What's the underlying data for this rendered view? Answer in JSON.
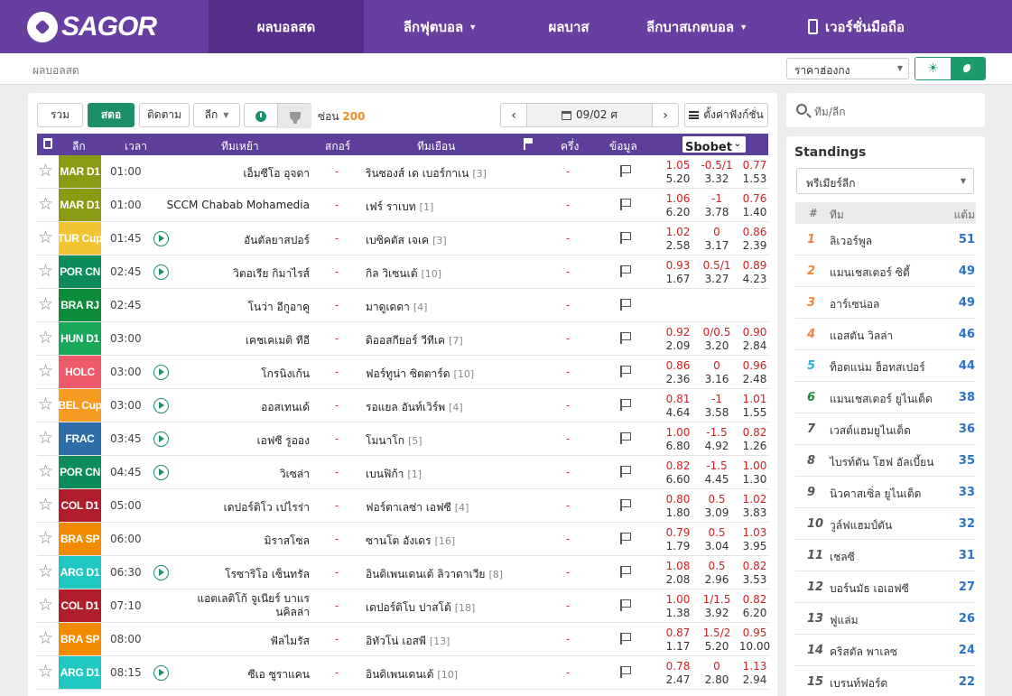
{
  "header": {
    "logo_text": "SAGOR",
    "nav": [
      {
        "label": "ผลบอลสด",
        "active": true,
        "caret": false
      },
      {
        "label": "ลีกฟุตบอล",
        "active": false,
        "caret": true
      },
      {
        "label": "ผลบาส",
        "active": false,
        "caret": false
      },
      {
        "label": "ลีกบาสเกตบอล",
        "active": false,
        "caret": true
      },
      {
        "label": "เวอร์ชั่นมือถือ",
        "active": false,
        "caret": false,
        "phone_icon": true
      }
    ],
    "caret_glyph": "▼"
  },
  "subbar": {
    "breadcrumb": "ผลบอลสด",
    "price_select": "ราคาฮ่องกง",
    "theme_light_icon": "sun-icon",
    "theme_dark_icon": "moon-icon"
  },
  "toolbar": {
    "all_label": "รวม",
    "live_label": "สดอ",
    "follow_label": "ติดตาม",
    "league_label": "ลีก",
    "hide_label": "ซ่อน",
    "hide_count": "200",
    "date": "09/02 ศ",
    "prev": "‹",
    "next": "›",
    "settings_label": "ตั้งค่าฟังก์ชั่น"
  },
  "table_header": {
    "league": "ลีก",
    "time": "เวลา",
    "home": "ทีมเหย้า",
    "score": "สกอร์",
    "away": "ทีมเยือน",
    "half": "ครึ่ง",
    "info": "ข้อมูล",
    "bookmaker": "Sbobet"
  },
  "colors": {
    "brand": "#673fa0",
    "nav_active": "#552e8a",
    "green": "#1d8f68",
    "header": "#5b3f9b",
    "odds_red": "#c22",
    "points_blue": "#2a73c8"
  },
  "matches": [
    {
      "league": "MAR D1",
      "color": "#8a9a13",
      "time": "01:00",
      "live": false,
      "home": "เอ็มซีโอ อุจดา",
      "score": "-",
      "away": "รินซองส์ เด เบอร์กาเน",
      "rank": "[3]",
      "half": "-",
      "odds": [
        [
          "1.05",
          "5.20"
        ],
        [
          "-0.5/1",
          "3.32"
        ],
        [
          "0.77",
          "1.53"
        ]
      ]
    },
    {
      "league": "MAR D1",
      "color": "#8a9a13",
      "time": "01:00",
      "live": false,
      "home": "SCCM Chabab Mohamedia",
      "score": "-",
      "away": "เฟร์ ราเบท",
      "rank": "[1]",
      "half": "-",
      "odds": [
        [
          "1.06",
          "6.20"
        ],
        [
          "-1",
          "3.78"
        ],
        [
          "0.76",
          "1.40"
        ]
      ]
    },
    {
      "league": "TUR Cup",
      "color": "#f3c431",
      "time": "01:45",
      "live": true,
      "home": "อันตัลยาสปอร์",
      "score": "-",
      "away": "เบซิคตัส เจเค",
      "rank": "[3]",
      "half": "-",
      "odds": [
        [
          "1.02",
          "2.58"
        ],
        [
          "0",
          "3.17"
        ],
        [
          "0.86",
          "2.39"
        ]
      ]
    },
    {
      "league": "POR CN",
      "color": "#0b8c5a",
      "time": "02:45",
      "live": true,
      "home": "วิตอเรีย กิมาไรส์",
      "score": "-",
      "away": "กิล วิเซนเต้",
      "rank": "[10]",
      "half": "-",
      "odds": [
        [
          "0.93",
          "1.67"
        ],
        [
          "0.5/1",
          "3.27"
        ],
        [
          "0.89",
          "4.23"
        ]
      ]
    },
    {
      "league": "BRA RJ",
      "color": "#0b8c3a",
      "time": "02:45",
      "live": false,
      "home": "โนว่า อีกูอาคู",
      "score": "-",
      "away": "มาดูเดดา",
      "rank": "[4]",
      "half": "-",
      "odds": null
    },
    {
      "league": "HUN D1",
      "color": "#18a85a",
      "time": "03:00",
      "live": false,
      "home": "เคชเคเมติ ทีอี",
      "score": "-",
      "away": "ดิออสกียอร์ วีทีเค",
      "rank": "[7]",
      "half": "-",
      "odds": [
        [
          "0.92",
          "2.09"
        ],
        [
          "0/0.5",
          "3.20"
        ],
        [
          "0.90",
          "2.84"
        ]
      ]
    },
    {
      "league": "HOLC",
      "color": "#ee5a6a",
      "time": "03:00",
      "live": true,
      "home": "โกรนิงเก้น",
      "score": "-",
      "away": "ฟอร์ทูน่า ซิตตาร์ด",
      "rank": "[10]",
      "half": "-",
      "odds": [
        [
          "0.86",
          "2.36"
        ],
        [
          "0",
          "3.16"
        ],
        [
          "0.96",
          "2.48"
        ]
      ]
    },
    {
      "league": "BEL Cup",
      "color": "#f79b22",
      "time": "03:00",
      "live": true,
      "home": "ออสเทนเด้",
      "score": "-",
      "away": "รอแยล อันท์เวิร์พ",
      "rank": "[4]",
      "half": "-",
      "odds": [
        [
          "0.81",
          "4.64"
        ],
        [
          "-1",
          "3.58"
        ],
        [
          "1.01",
          "1.55"
        ]
      ]
    },
    {
      "league": "FRAC",
      "color": "#2d6ea8",
      "time": "03:45",
      "live": true,
      "home": "เอฟซี รูออง",
      "score": "-",
      "away": "โมนาโก",
      "rank": "[5]",
      "half": "-",
      "odds": [
        [
          "1.00",
          "6.80"
        ],
        [
          "-1.5",
          "4.92"
        ],
        [
          "0.82",
          "1.26"
        ]
      ]
    },
    {
      "league": "POR CN",
      "color": "#0b8c5a",
      "time": "04:45",
      "live": true,
      "home": "วิเซล่า",
      "score": "-",
      "away": "เบนฟิก้า",
      "rank": "[1]",
      "half": "-",
      "odds": [
        [
          "0.82",
          "6.60"
        ],
        [
          "-1.5",
          "4.45"
        ],
        [
          "1.00",
          "1.30"
        ]
      ]
    },
    {
      "league": "COL D1",
      "color": "#b01e2c",
      "time": "05:00",
      "live": false,
      "home": "เดปอร์ติโว เปไรร่า",
      "score": "-",
      "away": "ฟอร์ตาเลซ่า เอฟซี",
      "rank": "[4]",
      "half": "-",
      "odds": [
        [
          "0.80",
          "1.80"
        ],
        [
          "0.5",
          "3.09"
        ],
        [
          "1.02",
          "3.83"
        ]
      ]
    },
    {
      "league": "BRA SP",
      "color": "#f38b00",
      "time": "06:00",
      "live": false,
      "home": "มิราสโซล",
      "score": "-",
      "away": "ซานโต อังเดร",
      "rank": "[16]",
      "half": "-",
      "odds": [
        [
          "0.79",
          "1.79"
        ],
        [
          "0.5",
          "3.04"
        ],
        [
          "1.03",
          "3.95"
        ]
      ]
    },
    {
      "league": "ARG D1",
      "color": "#1fc8c0",
      "time": "06:30",
      "live": true,
      "home": "โรซาริโอ เซ็นทรัล",
      "score": "-",
      "away": "อินดิเพนเดนเต้ ลิวาดาเวีย",
      "rank": "[8]",
      "half": "-",
      "odds": [
        [
          "1.08",
          "2.08"
        ],
        [
          "0.5",
          "2.96"
        ],
        [
          "0.82",
          "3.53"
        ]
      ]
    },
    {
      "league": "COL D1",
      "color": "#b01e2c",
      "time": "07:10",
      "live": false,
      "home": "แอตเลติโก้ จูเนียร์ บาแรนคิลล่า",
      "score": "-",
      "away": "เดปอร์ติโบ ปาสโต้",
      "rank": "[18]",
      "half": "-",
      "odds": [
        [
          "1.00",
          "1.38"
        ],
        [
          "1/1.5",
          "3.92"
        ],
        [
          "0.82",
          "6.20"
        ]
      ]
    },
    {
      "league": "BRA SP",
      "color": "#f38b00",
      "time": "08:00",
      "live": false,
      "home": "ฟัลไมรัส",
      "score": "-",
      "away": "อิทัวโน่ เอสพี",
      "rank": "[13]",
      "half": "-",
      "odds": [
        [
          "0.87",
          "1.17"
        ],
        [
          "1.5/2",
          "5.20"
        ],
        [
          "0.95",
          "10.00"
        ]
      ]
    },
    {
      "league": "ARG D1",
      "color": "#1fc8c0",
      "time": "08:15",
      "live": true,
      "home": "ซีเอ ซูราแคน",
      "score": "-",
      "away": "อินดิเพนเดนเต้",
      "rank": "[10]",
      "half": "-",
      "odds": [
        [
          "0.78",
          "2.47"
        ],
        [
          "0",
          "2.80"
        ],
        [
          "1.13",
          "2.94"
        ]
      ]
    }
  ],
  "sidebar": {
    "search_placeholder": "ทีม/ลีก",
    "standings_title": "Standings",
    "league_select": "พรีเมียร์ลีก",
    "head_rank": "#",
    "head_team": "ทีม",
    "head_points": "แต้ม",
    "rows": [
      {
        "rank": "1",
        "team": "ลิเวอร์พูล",
        "points": "51",
        "color": "#f0823a"
      },
      {
        "rank": "2",
        "team": "แมนเชสเตอร์ ซิตี้",
        "points": "49",
        "color": "#f0823a"
      },
      {
        "rank": "3",
        "team": "อาร์เซน่อล",
        "points": "49",
        "color": "#f0823a"
      },
      {
        "rank": "4",
        "team": "แอสตัน วิลล่า",
        "points": "46",
        "color": "#f0823a"
      },
      {
        "rank": "5",
        "team": "ท็อตแน่ม ฮ็อทสเปอร์",
        "points": "44",
        "color": "#1fb4d8"
      },
      {
        "rank": "6",
        "team": "แมนเชสเตอร์ ยูไนเต็ด",
        "points": "38",
        "color": "#1d8f3a"
      },
      {
        "rank": "7",
        "team": "เวสต์แฮมยูไนเต็ด",
        "points": "36",
        "color": "#555"
      },
      {
        "rank": "8",
        "team": "ไบรท์ตัน โฮฟ อัลเบี้ยน",
        "points": "35",
        "color": "#555"
      },
      {
        "rank": "9",
        "team": "นิวคาสเซิ่ล ยูไนเต็ด",
        "points": "33",
        "color": "#555"
      },
      {
        "rank": "10",
        "team": "วูล์ฟแฮมป์ตัน",
        "points": "32",
        "color": "#555"
      },
      {
        "rank": "11",
        "team": "เชลซี",
        "points": "31",
        "color": "#555"
      },
      {
        "rank": "12",
        "team": "บอร์นมัธ เอเอฟซี",
        "points": "27",
        "color": "#555"
      },
      {
        "rank": "13",
        "team": "ฟูแล่ม",
        "points": "26",
        "color": "#555"
      },
      {
        "rank": "14",
        "team": "คริสตัล พาเลซ",
        "points": "24",
        "color": "#555"
      },
      {
        "rank": "15",
        "team": "เบรนท์ฟอร์ด",
        "points": "22",
        "color": "#555"
      }
    ]
  }
}
